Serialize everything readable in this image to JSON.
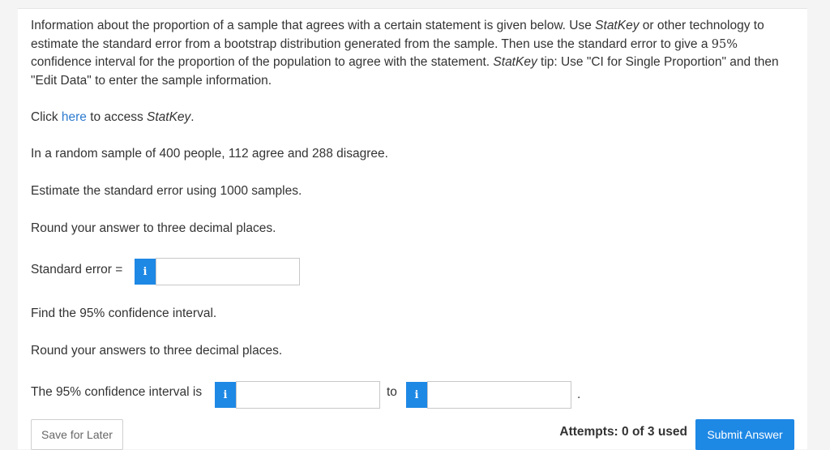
{
  "question": {
    "intro_part1": "Information about the proportion of a sample that agrees with a certain statement is given below. Use ",
    "statkey": "StatKey",
    "intro_part2": " or other technology to estimate the standard error from a bootstrap distribution generated from the sample. Then use the standard error to give a ",
    "intro_percent": "95%",
    "intro_part3": " confidence interval for the proportion of the population to agree with the statement. ",
    "tip_label": "StatKey",
    "intro_part4": " tip: Use \"CI for Single Proportion\" and then \"Edit Data\" to enter the sample information.",
    "click_prefix": "Click ",
    "click_link": "here",
    "click_suffix": " to access ",
    "click_statkey": "StatKey",
    "click_end": ".",
    "sample_info": "In a random sample of 400 people, 112 agree and 288 disagree.",
    "estimate_se": "Estimate the standard error using 1000 samples.",
    "round_1": "Round your answer to three decimal places.",
    "se_label": "Standard error =",
    "find_ci": "Find the 95% confidence interval.",
    "round_2": "Round your answers to three decimal places.",
    "ci_label": "The 95% confidence interval is",
    "ci_to": "to",
    "ci_end": "."
  },
  "inputs": {
    "standard_error": "",
    "ci_lower": "",
    "ci_upper": ""
  },
  "info_icon": {
    "glyph": "i",
    "name": "info-icon"
  },
  "footer": {
    "save_label": "Save for Later",
    "attempts_text": "Attempts: 0 of 3 used",
    "submit_label": "Submit Answer"
  },
  "colors": {
    "accent": "#1e88e5",
    "link": "#2e7bcf",
    "text": "#333333"
  }
}
